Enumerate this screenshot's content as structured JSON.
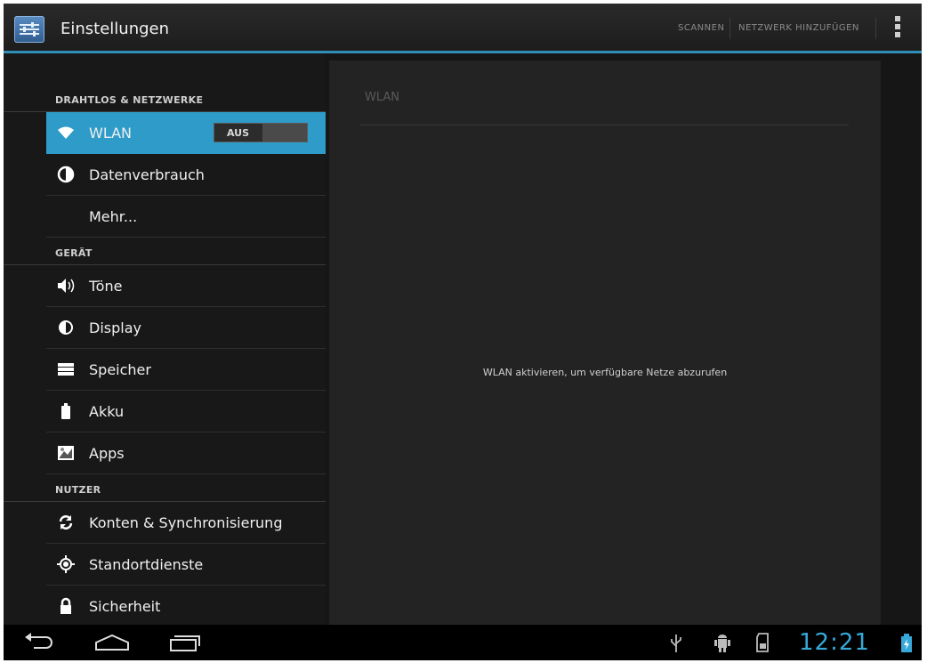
{
  "actionbar": {
    "title": "Einstellungen",
    "scan_label": "SCANNEN",
    "add_network_label": "NETZWERK HINZUFÜGEN"
  },
  "sections": [
    {
      "header": "DRAHTLOS & NETZWERKE",
      "items": [
        {
          "label": "WLAN",
          "icon": "wifi-icon",
          "toggle": "AUS",
          "active": true
        },
        {
          "label": "Datenverbrauch",
          "icon": "data-usage-icon"
        },
        {
          "label": "Mehr...",
          "icon": ""
        }
      ]
    },
    {
      "header": "GERÄT",
      "items": [
        {
          "label": "Töne",
          "icon": "speaker-icon"
        },
        {
          "label": "Display",
          "icon": "brightness-icon"
        },
        {
          "label": "Speicher",
          "icon": "storage-icon"
        },
        {
          "label": "Akku",
          "icon": "battery-icon"
        },
        {
          "label": "Apps",
          "icon": "apps-icon"
        }
      ]
    },
    {
      "header": "NUTZER",
      "items": [
        {
          "label": "Konten & Synchronisierung",
          "icon": "sync-icon"
        },
        {
          "label": "Standortdienste",
          "icon": "location-icon"
        },
        {
          "label": "Sicherheit",
          "icon": "lock-icon"
        }
      ]
    }
  ],
  "detail": {
    "title": "WLAN",
    "message": "WLAN aktivieren, um verfügbare Netze abzurufen"
  },
  "statusbar": {
    "clock": "12:21"
  },
  "colors": {
    "accent": "#2f9bc8",
    "clock": "#36a9d8"
  }
}
